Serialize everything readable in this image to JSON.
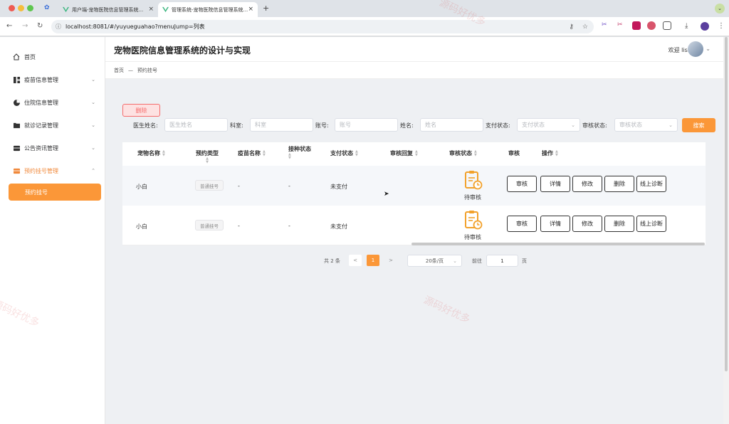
{
  "browser": {
    "tabs": [
      {
        "title": "用户端-宠物医院信息管理系统..."
      },
      {
        "title": "管理系统-宠物医院信息管理系统..."
      }
    ],
    "url": "localhost:8081/#/yuyueguahao?menuJump=列表"
  },
  "app": {
    "title": "宠物医院信息管理系统的设计与实现",
    "welcome": "欢迎 lisi"
  },
  "sidebar": {
    "items": [
      {
        "label": "首页"
      },
      {
        "label": "疫苗信息管理"
      },
      {
        "label": "住院信息管理"
      },
      {
        "label": "就诊记录管理"
      },
      {
        "label": "公告资讯管理"
      },
      {
        "label": "预约挂号管理"
      }
    ],
    "active_sub": "预约挂号"
  },
  "breadcrumb": {
    "home": "首页",
    "sep": "—",
    "current": "预约挂号"
  },
  "toolbar": {
    "delete_label": "删除",
    "search_label": "搜索"
  },
  "filters": [
    {
      "label": "医生姓名:",
      "placeholder": "医生姓名"
    },
    {
      "label": "科室:",
      "placeholder": "科室"
    },
    {
      "label": "账号:",
      "placeholder": "账号"
    },
    {
      "label": "姓名:",
      "placeholder": "姓名"
    },
    {
      "label": "支付状态:",
      "placeholder": "支付状态"
    },
    {
      "label": "审核状态:",
      "placeholder": "审核状态"
    }
  ],
  "table": {
    "headers": [
      "宠物名称",
      "预约类型",
      "疫苗名称",
      "接种状态",
      "支付状态",
      "审核回复",
      "审核状态",
      "审核",
      "操作"
    ],
    "rows": [
      {
        "pet": "小白",
        "type": "普通挂号",
        "vaccine": "-",
        "vacc_status": "-",
        "pay": "未支付",
        "reply": "",
        "audit": "待审核"
      },
      {
        "pet": "小白",
        "type": "普通挂号",
        "vaccine": "-",
        "vacc_status": "-",
        "pay": "未支付",
        "reply": "",
        "audit": "待审核"
      }
    ],
    "actions": [
      "审核",
      "详情",
      "修改",
      "删除",
      "线上诊断"
    ]
  },
  "pagination": {
    "total": "共 2 条",
    "prev": "<",
    "page": "1",
    "next": ">",
    "size": "20条/页",
    "goto": "前往",
    "goto_value": "1",
    "page_unit": "页"
  },
  "watermark": "源码好优多",
  "colors": {
    "accent": "#fb9738",
    "danger": "#f56c6c"
  }
}
